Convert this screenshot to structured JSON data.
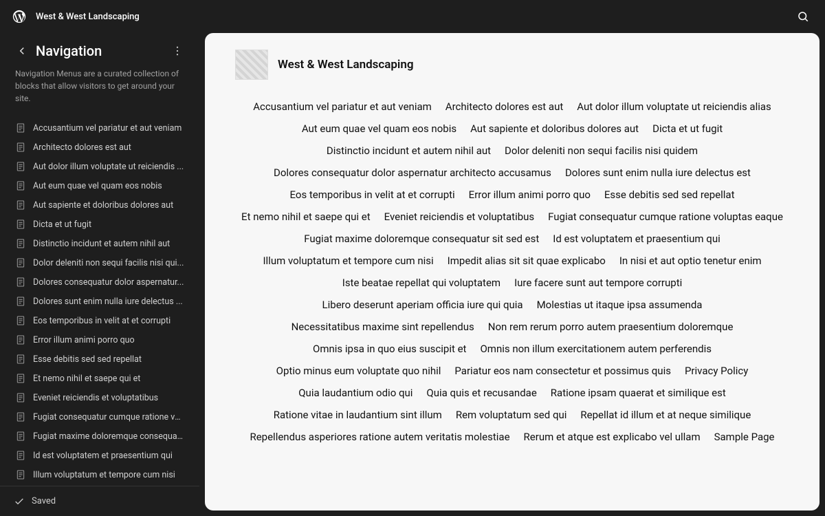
{
  "siteName": "West & West Landscaping",
  "sidebar": {
    "title": "Navigation",
    "description": "Navigation Menus are a curated collection of blocks that allow visitors to get around your site."
  },
  "menuItems": [
    "Accusantium vel pariatur et aut veniam",
    "Architecto dolores est aut",
    "Aut dolor illum voluptate ut reiciendis ...",
    "Aut eum quae vel quam eos nobis",
    "Aut sapiente et doloribus dolores aut",
    "Dicta et ut fugit",
    "Distinctio incidunt et autem nihil aut",
    "Dolor deleniti non sequi facilis nisi qui...",
    "Dolores consequatur dolor aspernatur...",
    "Dolores sunt enim nulla iure delectus ...",
    "Eos temporibus in velit at et corrupti",
    "Error illum animi porro quo",
    "Esse debitis sed sed repellat",
    "Et nemo nihil et saepe qui et",
    "Eveniet reiciendis et voluptatibus",
    "Fugiat consequatur cumque ratione vo...",
    "Fugiat maxime doloremque consequat...",
    "Id est voluptatem et praesentium qui",
    "Illum voluptatum et tempore cum nisi"
  ],
  "footer": {
    "status": "Saved"
  },
  "preview": {
    "title": "West & West Landscaping",
    "links": [
      "Accusantium vel pariatur et aut veniam",
      "Architecto dolores est aut",
      "Aut dolor illum voluptate ut reiciendis alias",
      "Aut eum quae vel quam eos nobis",
      "Aut sapiente et doloribus dolores aut",
      "Dicta et ut fugit",
      "Distinctio incidunt et autem nihil aut",
      "Dolor deleniti non sequi facilis nisi quidem",
      "Dolores consequatur dolor aspernatur architecto accusamus",
      "Dolores sunt enim nulla iure delectus est",
      "Eos temporibus in velit at et corrupti",
      "Error illum animi porro quo",
      "Esse debitis sed sed repellat",
      "Et nemo nihil et saepe qui et",
      "Eveniet reiciendis et voluptatibus",
      "Fugiat consequatur cumque ratione voluptas eaque",
      "Fugiat maxime doloremque consequatur sit sed est",
      "Id est voluptatem et praesentium qui",
      "Illum voluptatum et tempore cum nisi",
      "Impedit alias sit sit quae explicabo",
      "In nisi et aut optio tenetur enim",
      "Iste beatae repellat qui voluptatem",
      "Iure facere sunt aut tempore corrupti",
      "Libero deserunt aperiam officia iure qui quia",
      "Molestias ut itaque ipsa assumenda",
      "Necessitatibus maxime sint repellendus",
      "Non rem rerum porro autem praesentium doloremque",
      "Omnis ipsa in quo eius suscipit et",
      "Omnis non illum exercitationem autem perferendis",
      "Optio minus eum voluptate quo nihil",
      "Pariatur eos nam consectetur et possimus quis",
      "Privacy Policy",
      "Quia laudantium odio qui",
      "Quia quis et recusandae",
      "Ratione ipsam quaerat et similique est",
      "Ratione vitae in laudantium sint illum",
      "Rem voluptatum sed qui",
      "Repellat id illum et at neque similique",
      "Repellendus asperiores ratione autem veritatis molestiae",
      "Rerum et atque est explicabo vel ullam",
      "Sample Page"
    ]
  }
}
